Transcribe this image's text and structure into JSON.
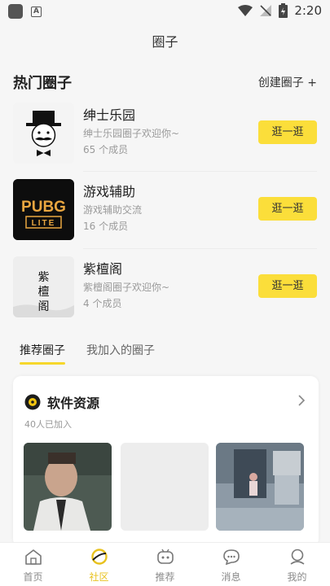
{
  "status_bar": {
    "time": "2:20"
  },
  "page": {
    "title": "圈子"
  },
  "hot": {
    "title": "热门圈子",
    "create_label": "创建圈子 +",
    "circles": [
      {
        "name": "绅士乐园",
        "desc": "绅士乐园圈子欢迎你~",
        "members": "65 个成员",
        "button": "逛一逛"
      },
      {
        "name": "游戏辅助",
        "desc": "游戏辅助交流",
        "members": "16 个成员",
        "button": "逛一逛",
        "logo_text_top": "PUBG",
        "logo_text_bottom": "LITE"
      },
      {
        "name": "紫檀阁",
        "desc": "紫檀阁圈子欢迎你~",
        "members": "4 个成员",
        "button": "逛一逛",
        "logo_text": "紫檀阁"
      }
    ]
  },
  "tabs": [
    {
      "label": "推荐圈子",
      "active": true
    },
    {
      "label": "我加入的圈子",
      "active": false
    }
  ],
  "recommended": {
    "title": "软件资源",
    "count": "40人已加入"
  },
  "bottom_nav": [
    {
      "label": "首页",
      "icon": "home-icon"
    },
    {
      "label": "社区",
      "icon": "community-icon",
      "active": true
    },
    {
      "label": "推荐",
      "icon": "recommend-icon"
    },
    {
      "label": "消息",
      "icon": "message-icon"
    },
    {
      "label": "我的",
      "icon": "profile-icon"
    }
  ],
  "colors": {
    "accent": "#fbde3a",
    "active_nav": "#e8c21f"
  }
}
